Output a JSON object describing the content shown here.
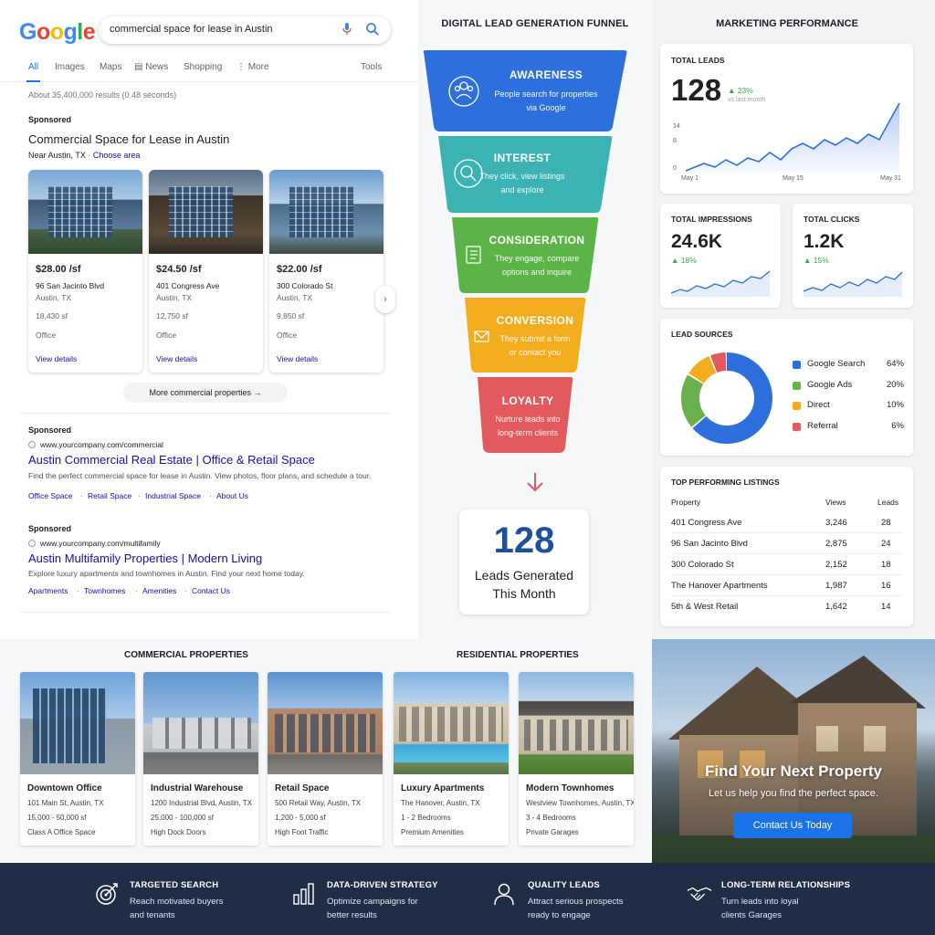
{
  "search": {
    "logo": [
      "G",
      "o",
      "o",
      "g",
      "l",
      "e"
    ],
    "logo_colors": [
      "#4285f4",
      "#ea4335",
      "#fbbc05",
      "#4285f4",
      "#34a853",
      "#ea4335"
    ],
    "query": "commercial space for lease in Austin",
    "tabs": [
      "All",
      "Images",
      "Maps",
      "News",
      "Shopping",
      "More"
    ],
    "tools": "Tools",
    "result_stats": "About 35,400,000 results (0.48 seconds)",
    "sponsored": "Sponsored",
    "local_title": "Commercial Space for Lease in Austin",
    "near": "Near Austin, TX",
    "choose_area": "Choose area",
    "listings": [
      {
        "price": "$28.00 /sf",
        "address": "96 San Jacinto Blvd",
        "city": "Austin, TX",
        "size": "18,430 sf",
        "type": "Office",
        "link": "View details"
      },
      {
        "price": "$24.50 /sf",
        "address": "401 Congress Ave",
        "city": "Austin, TX",
        "size": "12,750 sf",
        "type": "Office",
        "link": "View details"
      },
      {
        "price": "$22.00 /sf",
        "address": "300 Colorado St",
        "city": "Austin, TX",
        "size": "9,850 sf",
        "type": "Office",
        "link": "View details"
      }
    ],
    "more_button": "More commercial properties",
    "ads": [
      {
        "label": "Sponsored",
        "url": "www.yourcompany.com/commercial",
        "title": "Austin Commercial Real Estate | Office & Retail Space",
        "desc": "Find the perfect commercial space for lease in Austin. View photos, floor plans, and schedule a tour.",
        "links": [
          "Office Space",
          "Retail Space",
          "Industrial Space",
          "About Us"
        ]
      },
      {
        "label": "Sponsored",
        "url": "www.yourcompany.com/multifamily",
        "title": "Austin Multifamily Properties | Modern Living",
        "desc": "Explore luxury apartments and townhomes in Austin. Find your next home today.",
        "links": [
          "Apartments",
          "Townhomes",
          "Amenities",
          "Contact Us"
        ]
      }
    ]
  },
  "funnel": {
    "title": "DIGITAL LEAD GENERATION FUNNEL",
    "stages": [
      {
        "name": "AWARENESS",
        "line1": "People search for properties",
        "line2": "via Google",
        "color": "#2d6fdc",
        "icon": "users-icon"
      },
      {
        "name": "INTEREST",
        "line1": "They click, view listings",
        "line2": "and explore",
        "color": "#3bb3b3",
        "icon": "magnifier-icon"
      },
      {
        "name": "CONSIDERATION",
        "line1": "They engage, compare",
        "line2": "options and inquire",
        "color": "#5cb347",
        "icon": "checklist-icon"
      },
      {
        "name": "CONVERSION",
        "line1": "They submit a form",
        "line2": "or contact you",
        "color": "#f2ac1d",
        "icon": "envelope-icon"
      },
      {
        "name": "LOYALTY",
        "line1": "Nurture leads into",
        "line2": "long-term clients",
        "color": "#e2595e",
        "icon": ""
      }
    ],
    "leads_number": "128",
    "leads_line1": "Leads Generated",
    "leads_line2": "This Month"
  },
  "marketing": {
    "title": "MARKETING PERFORMANCE",
    "total_leads": {
      "label": "TOTAL LEADS",
      "value": "128",
      "delta": "▲ 23%",
      "vs": "vs last month",
      "y_ticks": [
        "14",
        "8",
        "0"
      ],
      "x_ticks": [
        "May 1",
        "May 15",
        "May 31"
      ]
    },
    "impressions": {
      "label": "TOTAL IMPRESSIONS",
      "value": "24.6K",
      "delta": "▲ 18%"
    },
    "clicks": {
      "label": "TOTAL CLICKS",
      "value": "1.2K",
      "delta": "▲ 15%"
    },
    "lead_sources": {
      "label": "LEAD SOURCES",
      "items": [
        {
          "name": "Google Search",
          "value": "64%",
          "pct": 64,
          "color": "#2d6fdc"
        },
        {
          "name": "Google Ads",
          "value": "20%",
          "pct": 20,
          "color": "#6ab04c"
        },
        {
          "name": "Direct",
          "value": "10%",
          "pct": 10,
          "color": "#f2ac1d"
        },
        {
          "name": "Referral",
          "value": "6%",
          "pct": 6,
          "color": "#e2595e"
        }
      ]
    },
    "top_listings": {
      "label": "TOP PERFORMING LISTINGS",
      "headers": [
        "Property",
        "Views",
        "Leads"
      ],
      "rows": [
        [
          "401 Congress Ave",
          "3,246",
          "28"
        ],
        [
          "96 San Jacinto Blvd",
          "2,875",
          "24"
        ],
        [
          "300 Colorado St",
          "2,152",
          "18"
        ],
        [
          "The Hanover Apartments",
          "1,987",
          "16"
        ],
        [
          "5th & West Retail",
          "1,642",
          "14"
        ]
      ]
    }
  },
  "properties": {
    "commercial_title": "COMMERCIAL PROPERTIES",
    "residential_title": "RESIDENTIAL PROPERTIES",
    "cards": [
      {
        "name": "Downtown Office",
        "address": "101 Main St, Austin, TX",
        "size": "15,000 - 50,000 sf",
        "feature": "Class A Office Space"
      },
      {
        "name": "Industrial Warehouse",
        "address": "1200 Industrial Blvd, Austin, TX",
        "size": "25,000 - 100,000 sf",
        "feature": "High Dock Doors"
      },
      {
        "name": "Retail Space",
        "address": "500 Retail Way, Austin, TX",
        "size": "1,200 - 5,000 sf",
        "feature": "High Foot Traffic"
      },
      {
        "name": "Luxury Apartments",
        "address": "The Hanover, Austin, TX",
        "size": "1 - 2 Bedrooms",
        "feature": "Premium Amenities"
      },
      {
        "name": "Modern Townhomes",
        "address": "Westview Townhomes, Austin, TX",
        "size": "3 - 4 Bedrooms",
        "feature": "Private Garages"
      }
    ]
  },
  "hero": {
    "title": "Find Your Next Property",
    "subtitle": "Let us help you find the perfect space.",
    "button": "Contact Us Today"
  },
  "features": [
    {
      "title": "TARGETED SEARCH",
      "line1": "Reach motivated buyers",
      "line2": "and tenants",
      "icon": "target-icon"
    },
    {
      "title": "DATA-DRIVEN STRATEGY",
      "line1": "Optimize campaigns for",
      "line2": "better results",
      "icon": "bar-chart-icon"
    },
    {
      "title": "QUALITY LEADS",
      "line1": "Attract serious prospects",
      "line2": "ready to engage",
      "icon": "person-icon"
    },
    {
      "title": "LONG-TERM RELATIONSHIPS",
      "line1": "Turn leads into loyal",
      "line2": "clients Garages",
      "icon": "handshake-icon"
    }
  ]
}
